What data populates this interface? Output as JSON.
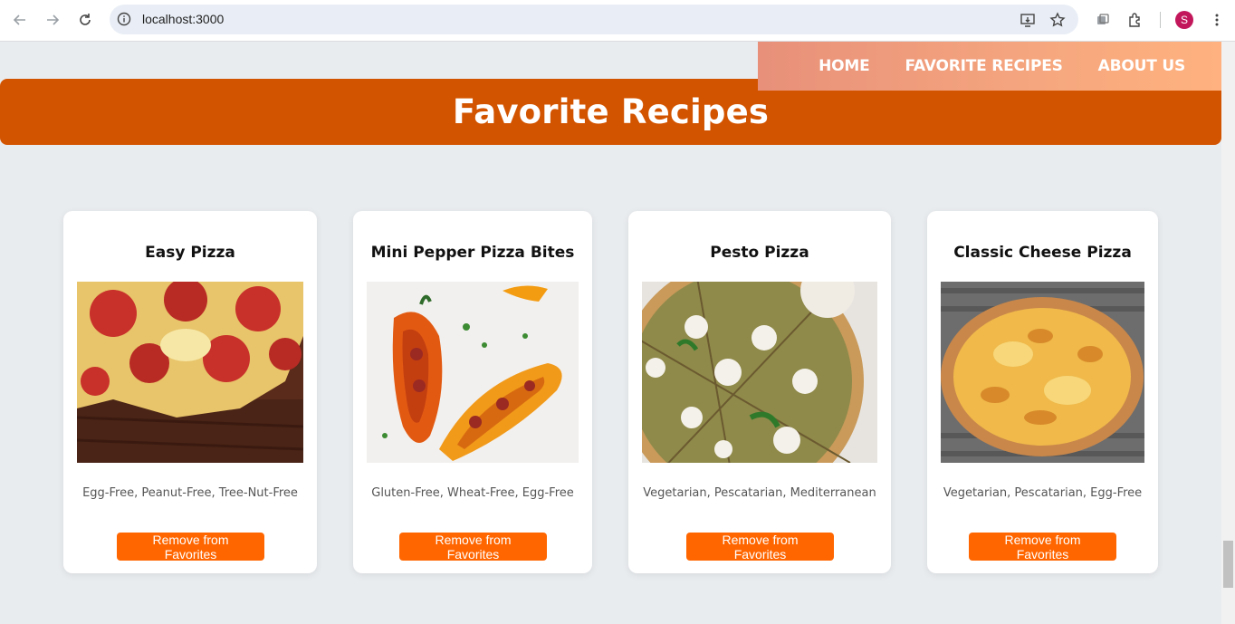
{
  "browser": {
    "url": "localhost:3000",
    "profile_initial": "S"
  },
  "nav": {
    "items": [
      {
        "label": "HOME"
      },
      {
        "label": "FAVORITE RECIPES"
      },
      {
        "label": "ABOUT US"
      }
    ]
  },
  "page": {
    "title": "Favorite Recipes"
  },
  "recipes": [
    {
      "title": "Easy Pizza",
      "tags": "Egg-Free, Peanut-Free, Tree-Nut-Free",
      "button": "Remove from Favorites"
    },
    {
      "title": "Mini Pepper Pizza Bites",
      "tags": "Gluten-Free, Wheat-Free, Egg-Free",
      "button": "Remove from Favorites"
    },
    {
      "title": "Pesto Pizza",
      "tags": "Vegetarian, Pescatarian, Mediterranean",
      "button": "Remove from Favorites"
    },
    {
      "title": "Classic Cheese Pizza",
      "tags": "Vegetarian, Pescatarian, Egg-Free",
      "button": "Remove from Favorites"
    }
  ],
  "colors": {
    "hero": "#d35400",
    "button": "#ff6600",
    "nav_gradient_start": "#e8907a",
    "nav_gradient_end": "#ffb27f"
  }
}
